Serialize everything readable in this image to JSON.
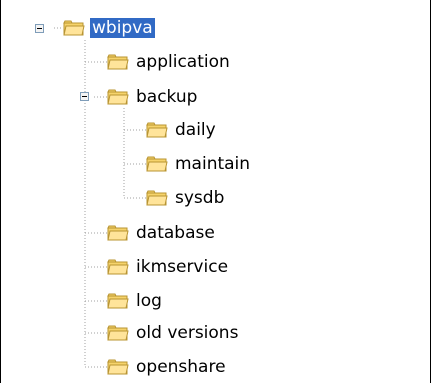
{
  "window": {
    "type": "folder-tree"
  },
  "tree": {
    "root": {
      "label": "wbipva",
      "expanded": true,
      "selected": true
    },
    "items": [
      {
        "label": "application",
        "depth": 1,
        "expanded": false,
        "has_children": false
      },
      {
        "label": "backup",
        "depth": 1,
        "expanded": true,
        "has_children": true
      },
      {
        "label": "daily",
        "depth": 2,
        "expanded": false,
        "has_children": false
      },
      {
        "label": "maintain",
        "depth": 2,
        "expanded": false,
        "has_children": false
      },
      {
        "label": "sysdb",
        "depth": 2,
        "expanded": false,
        "has_children": false
      },
      {
        "label": "database",
        "depth": 1,
        "expanded": false,
        "has_children": false
      },
      {
        "label": "ikmservice",
        "depth": 1,
        "expanded": false,
        "has_children": false
      },
      {
        "label": "log",
        "depth": 1,
        "expanded": false,
        "has_children": false
      },
      {
        "label": "old versions",
        "depth": 1,
        "expanded": false,
        "has_children": false
      },
      {
        "label": "openshare",
        "depth": 1,
        "expanded": false,
        "has_children": false
      }
    ]
  },
  "colors": {
    "selection": "#316ac5",
    "selection_text": "#ffffff",
    "folder_fill": "#f6d36b",
    "folder_outline": "#b89432",
    "guide_lines": "#a0a0a0",
    "expander_border": "#7f9db9",
    "panel_border": "#000000"
  },
  "icons": {
    "folder": "folder-icon",
    "collapse": "minus-box-icon"
  }
}
